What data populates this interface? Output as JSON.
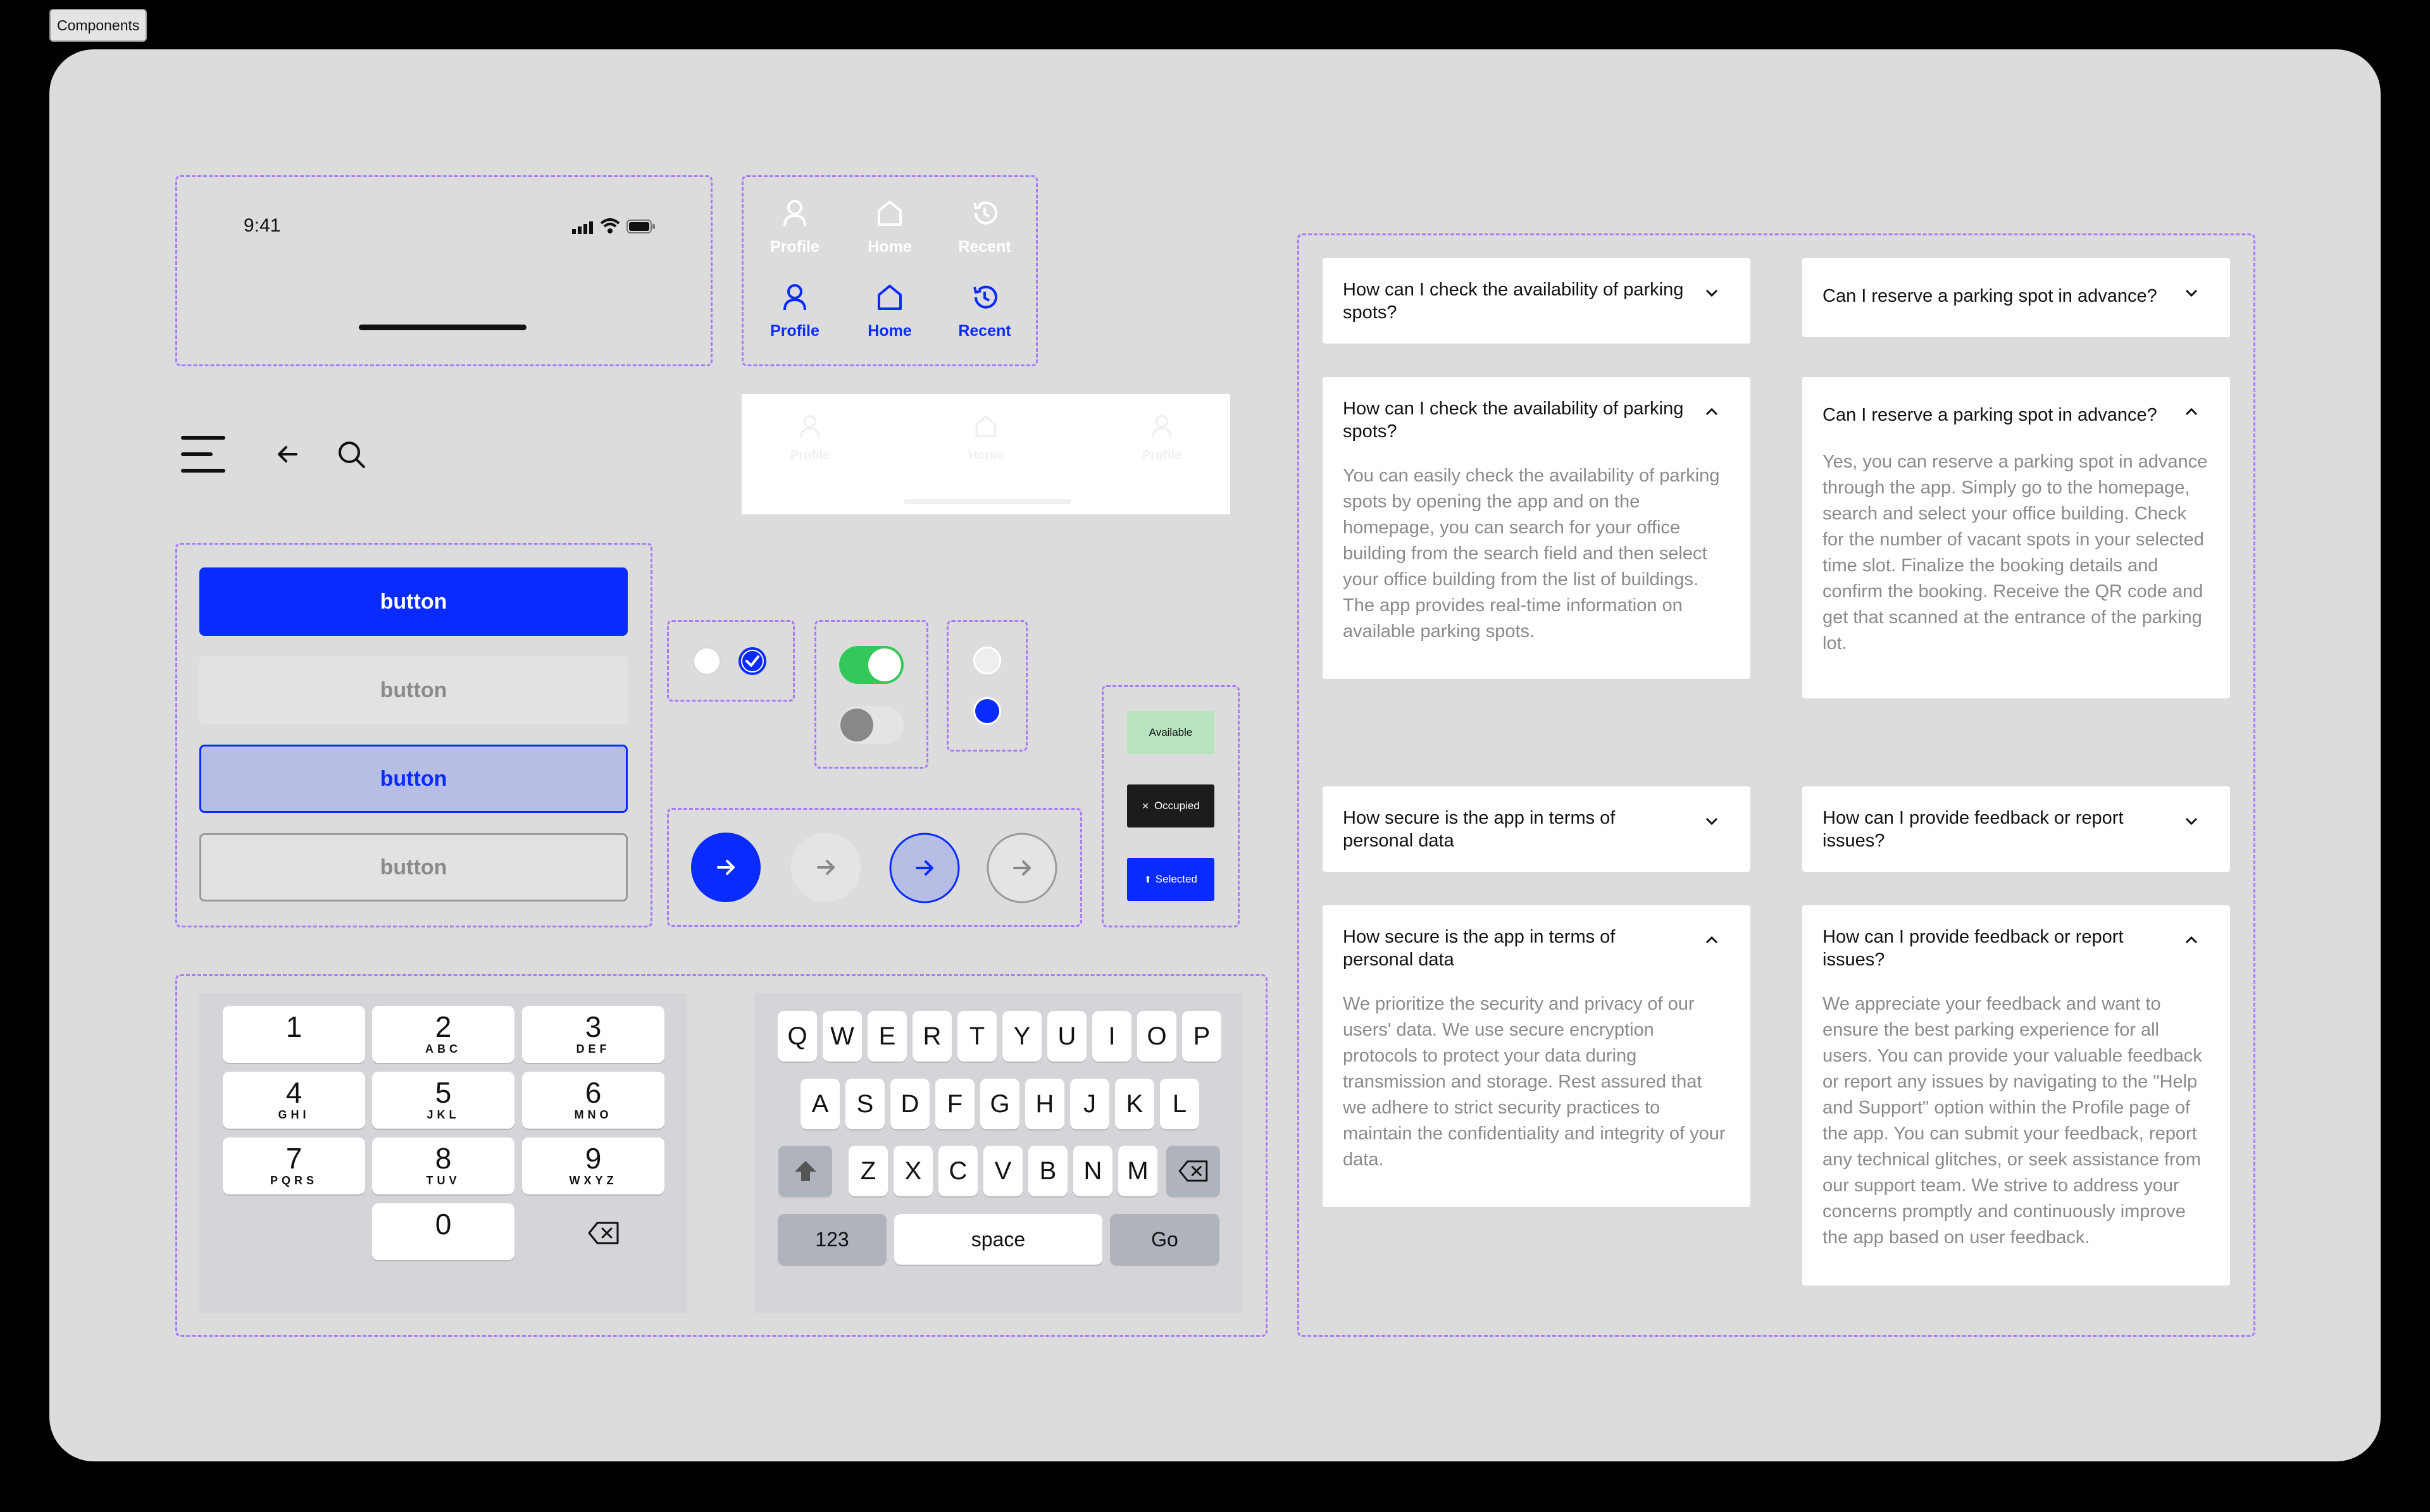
{
  "frame_label": "Components",
  "status_bar": {
    "time": "9:41"
  },
  "tab_bar": {
    "inactive": [
      {
        "label": "Profile"
      },
      {
        "label": "Home"
      },
      {
        "label": "Recent"
      }
    ],
    "active": [
      {
        "label": "Profile"
      },
      {
        "label": "Home"
      },
      {
        "label": "Recent"
      }
    ],
    "ghost": [
      {
        "label": "Profile"
      },
      {
        "label": "Home"
      },
      {
        "label": "Profile"
      }
    ],
    "active_color": "#0a2bff",
    "inactive_color": "#ffffff"
  },
  "buttons": {
    "primary": "button",
    "disabled": "button",
    "selected": "button",
    "outline": "button"
  },
  "chips": {
    "available": "Available",
    "occupied": "Occupied",
    "selected": "Selected"
  },
  "numpad": {
    "keys": [
      {
        "digit": "1",
        "letters": ""
      },
      {
        "digit": "2",
        "letters": "ABC"
      },
      {
        "digit": "3",
        "letters": "DEF"
      },
      {
        "digit": "4",
        "letters": "GHI"
      },
      {
        "digit": "5",
        "letters": "JKL"
      },
      {
        "digit": "6",
        "letters": "MNO"
      },
      {
        "digit": "7",
        "letters": "PQRS"
      },
      {
        "digit": "8",
        "letters": "TUV"
      },
      {
        "digit": "9",
        "letters": "WXYZ"
      },
      {
        "digit": "0",
        "letters": ""
      }
    ]
  },
  "keyboard": {
    "row1": [
      "Q",
      "W",
      "E",
      "R",
      "T",
      "Y",
      "U",
      "I",
      "O",
      "P"
    ],
    "row2": [
      "A",
      "S",
      "D",
      "F",
      "G",
      "H",
      "J",
      "K",
      "L"
    ],
    "row3": [
      "Z",
      "X",
      "C",
      "V",
      "B",
      "N",
      "M"
    ],
    "numbers_key": "123",
    "space_key": "space",
    "go_key": "Go"
  },
  "faq": [
    {
      "question": "How can I check the availability of parking spots?"
    },
    {
      "question": "Can I reserve a parking spot in advance?"
    },
    {
      "question": "How can I check the availability of parking spots?",
      "answer": "You can easily check the availability of parking spots by opening the app and on the homepage, you can search for your office building from the search field and then select your office building from the list of buildings. The app provides real-time information on available parking spots."
    },
    {
      "question": "Can I reserve a parking spot in advance?",
      "answer": "Yes, you can reserve a parking spot in advance through the app. Simply go to the homepage, search and select your office building. Check for the number of vacant spots in your selected time slot. Finalize the booking details and confirm the booking. Receive the QR code and get that scanned at the entrance of the parking lot."
    },
    {
      "question": "How secure is the app in terms of personal data"
    },
    {
      "question": "How can I provide feedback or report issues?"
    },
    {
      "question": "How secure is the app in terms of personal data",
      "answer": "We prioritize the security and privacy of our users' data. We use secure encryption protocols to protect your data during transmission and storage. Rest assured that we adhere to strict security practices to maintain the confidentiality and integrity of your data."
    },
    {
      "question": "How can I provide feedback or report issues?",
      "answer": "We appreciate your feedback and want to ensure the best parking experience for all users. You can provide your valuable feedback or report any issues by navigating to the \"Help and Support\" option within the Profile page of the app. You can submit your feedback, report any technical glitches, or seek assistance from our support team. We strive to address your concerns promptly and continuously improve the app based on user feedback."
    }
  ],
  "colors": {
    "primary": "#0a2bff",
    "canvas": "#dcdcdc",
    "dashed_border": "#a67cf7",
    "available_chip": "#b8e3bf",
    "toggle_on": "#34c759"
  }
}
